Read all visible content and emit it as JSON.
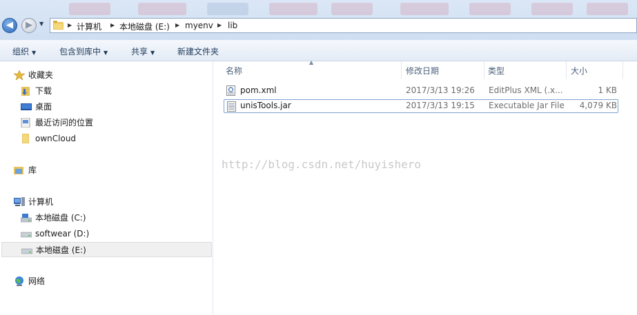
{
  "address_bar": {
    "breadcrumbs": [
      "计算机",
      "本地磁盘 (E:)",
      "myenv",
      "lib"
    ]
  },
  "toolbar": {
    "organize": "组织",
    "include_in_library": "包含到库中",
    "share": "共享",
    "new_folder": "新建文件夹"
  },
  "nav_pane": {
    "favorites": "收藏夹",
    "downloads": "下载",
    "desktop": "桌面",
    "recent_places": "最近访问的位置",
    "owncloud": "ownCloud",
    "libraries": "库",
    "computer": "计算机",
    "drive_c": "本地磁盘 (C:)",
    "drive_d": "softwear (D:)",
    "drive_e": "本地磁盘 (E:)",
    "network": "网络"
  },
  "columns": {
    "name": "名称",
    "modified": "修改日期",
    "type": "类型",
    "size": "大小"
  },
  "files": [
    {
      "name": "pom.xml",
      "modified": "2017/3/13 19:26",
      "type": "EditPlus XML (.x...",
      "size": "1 KB"
    },
    {
      "name": "unisTools.jar",
      "modified": "2017/3/13 19:15",
      "type": "Executable Jar File",
      "size": "4,079 KB"
    }
  ],
  "watermark": "http://blog.csdn.net/huyishero",
  "icons": {
    "back": "back-arrow-icon",
    "forward": "forward-arrow-icon",
    "folder": "folder-icon",
    "star": "favorites-star-icon",
    "drive": "hard-drive-icon",
    "network": "network-globe-icon"
  },
  "colors": {
    "toolbar_bg": "#e3ebf6",
    "selection_border": "#7da2ce",
    "back_button": "#2a65b8"
  }
}
